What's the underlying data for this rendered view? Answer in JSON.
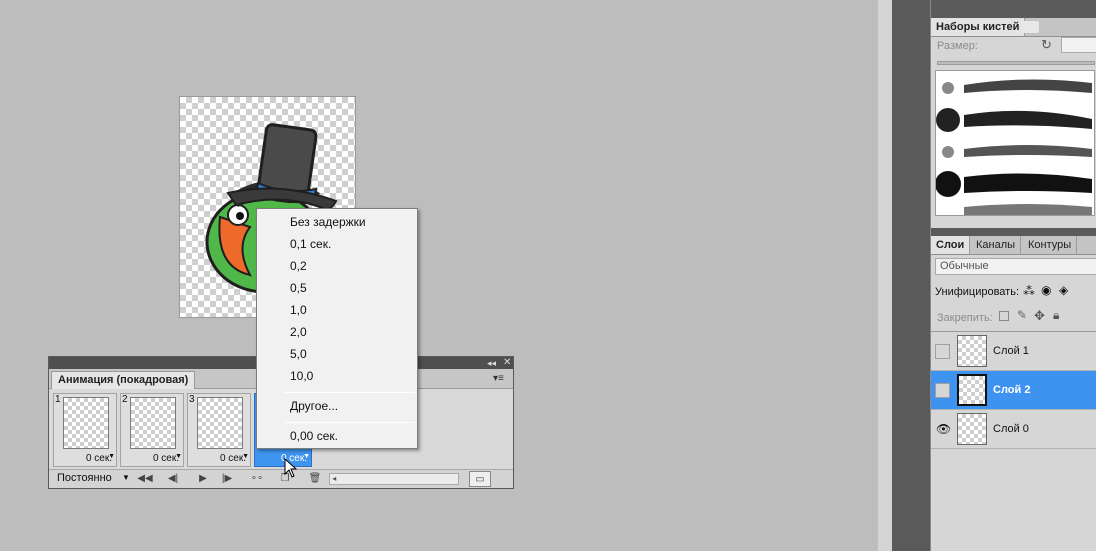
{
  "brush_presets": {
    "title": "Наборы кистей",
    "size_label": "Размер:"
  },
  "layers_panel": {
    "tabs": [
      "Слои",
      "Каналы",
      "Контуры"
    ],
    "blend_mode": "Обычные",
    "unify_label": "Унифицировать:",
    "lock_label": "Закрепить:",
    "layers": [
      {
        "name": "Слой 1",
        "selected": false,
        "visible": false
      },
      {
        "name": "Слой 2",
        "selected": true,
        "visible": false
      },
      {
        "name": "Слой 0",
        "selected": false,
        "visible": true
      }
    ]
  },
  "animation_panel": {
    "tab": "Анимация (покадровая)",
    "frames": [
      {
        "number": "1",
        "delay": "0 сек."
      },
      {
        "number": "2",
        "delay": "0 сек."
      },
      {
        "number": "3",
        "delay": "0 сек."
      },
      {
        "number": "",
        "delay": "0 сек."
      }
    ],
    "loop": "Постоянно"
  },
  "delay_menu": {
    "items": [
      "Без задержки",
      "0,1 сек.",
      "0,2",
      "0,5",
      "1,0",
      "2,0",
      "5,0",
      "10,0"
    ],
    "other": "Другое...",
    "current": "0,00 сек."
  },
  "colors": {
    "selection": "#3e93f0",
    "canvas_bg": "#bdbdbd",
    "panel_bg": "#d6d6d6"
  }
}
